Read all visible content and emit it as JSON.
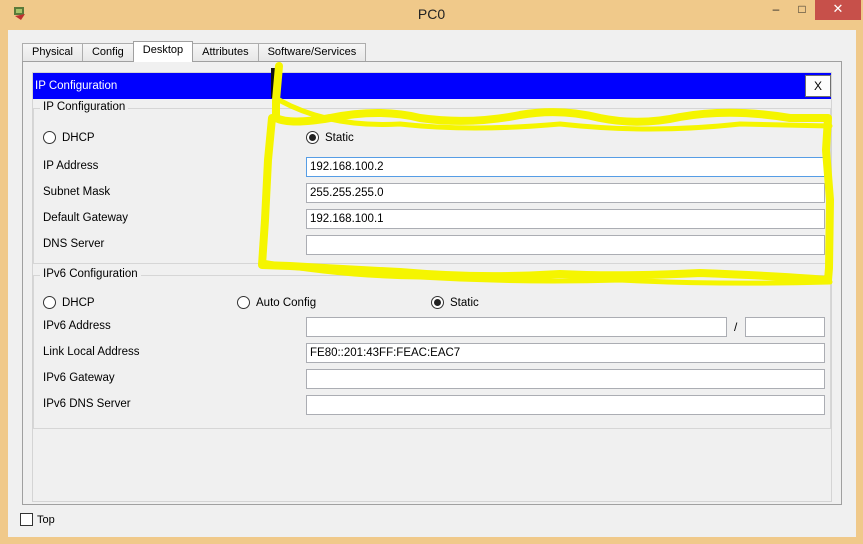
{
  "window": {
    "title": "PC0",
    "minimize": "–",
    "maximize": "□",
    "close": "✕"
  },
  "tabs": [
    {
      "label": "Physical"
    },
    {
      "label": "Config"
    },
    {
      "label": "Desktop",
      "active": true
    },
    {
      "label": "Attributes"
    },
    {
      "label": "Software/Services"
    }
  ],
  "ip_config": {
    "header_title": "IP Configuration",
    "close_label": "X",
    "ipv4": {
      "group_title": "IP Configuration",
      "dhcp_label": "DHCP",
      "static_label": "Static",
      "selected": "static",
      "ip_address_label": "IP Address",
      "ip_address_value": "192.168.100.2",
      "subnet_mask_label": "Subnet Mask",
      "subnet_mask_value": "255.255.255.0",
      "default_gateway_label": "Default Gateway",
      "default_gateway_value": "192.168.100.1",
      "dns_server_label": "DNS Server",
      "dns_server_value": ""
    },
    "ipv6": {
      "group_title": "IPv6 Configuration",
      "dhcp_label": "DHCP",
      "auto_config_label": "Auto Config",
      "static_label": "Static",
      "selected": "static",
      "address_label": "IPv6 Address",
      "address_value": "",
      "prefix_separator": "/",
      "prefix_value": "",
      "link_local_label": "Link Local Address",
      "link_local_value": "FE80::201:43FF:FEAC:EAC7",
      "gateway_label": "IPv6 Gateway",
      "gateway_value": "",
      "dns_server_label": "IPv6 DNS Server",
      "dns_server_value": ""
    }
  },
  "footer": {
    "top_label": "Top",
    "top_checked": false
  },
  "colors": {
    "header_bg": "#0000ff",
    "highlight": "#f5f500",
    "window_frame": "#f0c98a",
    "close_button": "#c7504a"
  }
}
